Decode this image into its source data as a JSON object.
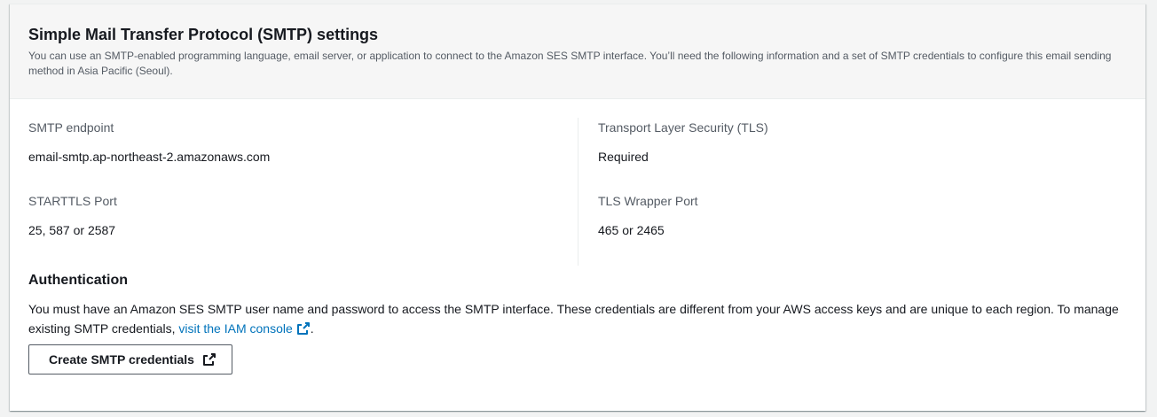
{
  "header": {
    "title": "Simple Mail Transfer Protocol (SMTP) settings",
    "description": "You can use an SMTP-enabled programming language, email server, or application to connect to the Amazon SES SMTP interface. You’ll need the following information and a set of SMTP credentials to configure this email sending method in Asia Pacific (Seoul)."
  },
  "settings": {
    "smtp_endpoint": {
      "label": "SMTP endpoint",
      "value": "email-smtp.ap-northeast-2.amazonaws.com"
    },
    "starttls_port": {
      "label": "STARTTLS Port",
      "value": "25, 587 or 2587"
    },
    "tls": {
      "label": "Transport Layer Security (TLS)",
      "value": "Required"
    },
    "tls_wrapper_port": {
      "label": "TLS Wrapper Port",
      "value": "465 or 2465"
    }
  },
  "authentication": {
    "title": "Authentication",
    "text_before_link": "You must have an Amazon SES SMTP user name and password to access the SMTP interface. These credentials are different from your AWS access keys and are unique to each region. To manage existing SMTP credentials, ",
    "link_label": "visit the IAM console",
    "text_after_link": ".",
    "button_label": "Create SMTP credentials"
  },
  "icons": {
    "external_link": "external-link-icon"
  },
  "colors": {
    "link": "#0073bb",
    "text": "#16191f",
    "secondary_text": "#545b64"
  }
}
